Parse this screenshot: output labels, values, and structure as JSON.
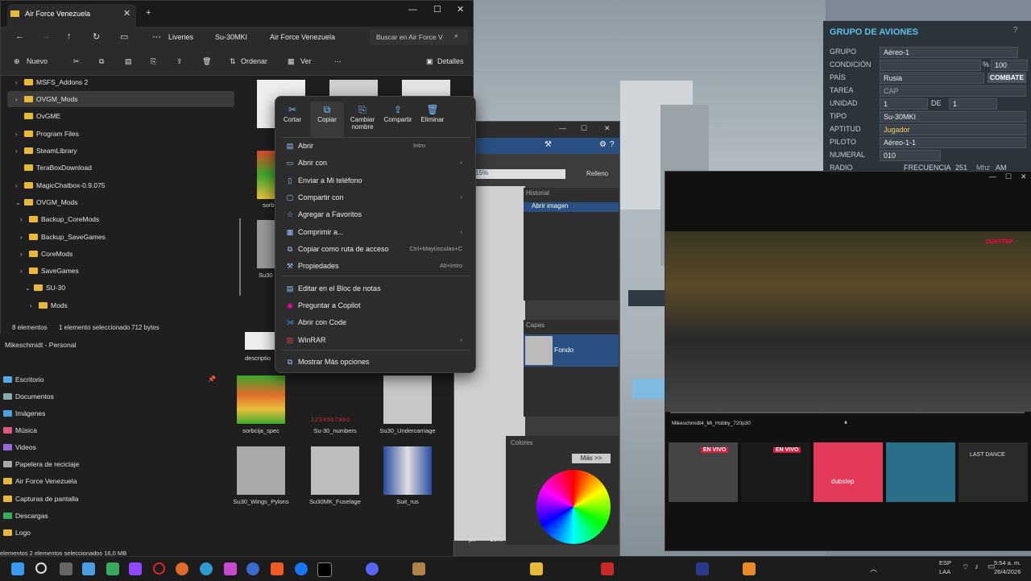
{
  "explorer": {
    "tab_title": "Air Force Venezuela",
    "breadcrumb": [
      "Liveries",
      "Su-30MKI",
      "Air Force Venezuela"
    ],
    "search_placeholder": "Buscar en Air Force V",
    "cmd": {
      "new": "Nuevo",
      "sort": "Ordenar",
      "view": "Ver",
      "details": "Detalles"
    },
    "tree": [
      "MSFS_Addons 2",
      "OVGM_Mods",
      "OvGME",
      "Program Files",
      "SteamLibrary",
      "TeraBoxDownload",
      "MagicChatbox-0.9.075",
      "OVGM_Mods",
      "Backup_CoreMods",
      "Backup_SaveGames",
      "CoreMods",
      "SaveGames",
      "SU-30",
      "Mods"
    ],
    "status": {
      "count": "8 elementos",
      "selected": "1 elemento seleccionado",
      "size": "712 bytes"
    },
    "quick_access_header": "Mikeschmidt - Personal",
    "quick_access": [
      "Escritorio",
      "Documentos",
      "Imágenes",
      "Música",
      "Videos",
      "Papelera de reciclaje",
      "Air Force Venezuela",
      "Capturas de pantalla",
      "Descargas",
      "Logo"
    ],
    "status2": "elementos   2 elementos seleccionados  16,0 MB",
    "files": [
      "descriptio",
      "sorbcija_spec",
      "Su-30_numbers",
      "Su30_Undercarriage",
      "Su30_Wings_Pylons",
      "Su30MK_Fuselage",
      "Suit_rus",
      "sorb",
      "Su30"
    ],
    "numbers_text": "1234567890"
  },
  "context_menu": {
    "quick_actions": [
      "Cortar",
      "Copiar",
      "Cambiar nombre",
      "Compartir",
      "Eliminar"
    ],
    "items": [
      {
        "label": "Abrir",
        "shortcut": "Intro"
      },
      {
        "label": "Abrir con",
        "shortcut": ""
      },
      {
        "label": "Enviar a Mi teléfono",
        "shortcut": ""
      },
      {
        "label": "Compartir con",
        "shortcut": ""
      },
      {
        "label": "Agregar a Favoritos",
        "shortcut": ""
      },
      {
        "label": "Comprimir a...",
        "shortcut": ""
      },
      {
        "label": "Copiar como ruta de acceso",
        "shortcut": "Ctrl+Mayúsculas+C"
      },
      {
        "label": "Propiedades",
        "shortcut": "Alt+Intro"
      },
      {
        "label": "Editar en el Bloc de notas",
        "shortcut": ""
      },
      {
        "label": "Preguntar a Copilot",
        "shortcut": ""
      },
      {
        "label": "Abrir con Code",
        "shortcut": ""
      },
      {
        "label": "WinRAR",
        "shortcut": ""
      },
      {
        "label": "Mostrar Más opciones",
        "shortcut": ""
      }
    ]
  },
  "paint": {
    "history_title": "Historial",
    "history_item": "Abrir imagen",
    "layers_title": "Capas",
    "layer_name": "Fondo",
    "colors_title": "Colores",
    "more_button": "Más >>",
    "fill_label": "Relleno",
    "zoom_pct": "15%",
    "unit": "px",
    "zoom": "16%"
  },
  "group_panel": {
    "title": "GRUPO DE AVIONES",
    "rows": [
      {
        "label": "GRUPO",
        "value": "Aéreo-1"
      },
      {
        "label": "CONDICIÓN",
        "value": "100"
      },
      {
        "label": "PAÍS",
        "value": "Rusia"
      },
      {
        "label": "TAREA",
        "value": "CAP"
      },
      {
        "label": "UNIDAD",
        "value": "1"
      },
      {
        "label": "TIPO",
        "value": "Su-30MKI"
      },
      {
        "label": "APTITUD",
        "value": "Jugador"
      },
      {
        "label": "PILOTO",
        "value": "Aéreo-1-1"
      },
      {
        "label": "NUMERAL",
        "value": "010"
      },
      {
        "label": "RADIO",
        "value": "251"
      }
    ],
    "combat_button": "COMBATE",
    "de_label": "DE",
    "unidad_max": "1",
    "freq_label": "FRECUENCIA",
    "mhz": "Mhz",
    "am": "AM",
    "percent": "%"
  },
  "video": {
    "caption": "Mikeschmidt4_Mi_Hobby_720p30",
    "live_badge": "EN VIVO",
    "dubstep_label": "dubstep",
    "last_dance": "LAST DANCE",
    "overlay_text": "DUBSTEP"
  },
  "taskbar": {
    "lang": "ESP",
    "lang2": "LAA",
    "time": "5:54 a. m.",
    "date": "26/4/2026"
  },
  "colors": {
    "accent": "#5fc0e8",
    "combat": "#4a5561",
    "live": "#d91f3d",
    "folder": "#e8b83b"
  }
}
